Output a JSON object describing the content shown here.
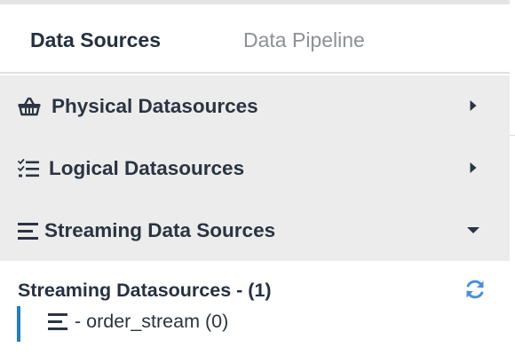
{
  "tabs": [
    {
      "label": "Data Sources",
      "active": true
    },
    {
      "label": "Data Pipeline",
      "active": false
    }
  ],
  "sections": [
    {
      "label": "Physical Datasources",
      "icon": "basket-icon",
      "caret": "caret-right-icon",
      "expanded": false
    },
    {
      "label": "Logical Datasources",
      "icon": "checklist-icon",
      "caret": "caret-right-icon",
      "expanded": false
    },
    {
      "label": "Streaming Data Sources",
      "icon": "bars-icon",
      "caret": "caret-down-icon",
      "expanded": true
    }
  ],
  "streaming": {
    "group_title": "Streaming Datasources - (1)",
    "refresh_icon": "refresh-icon",
    "items": [
      {
        "label": "- order_stream (0)",
        "icon": "bars-icon"
      }
    ]
  },
  "colors": {
    "accent": "#1e7fc6",
    "refresh": "#4a90d9",
    "section_bg": "#ececec",
    "active_tab": "#253142",
    "inactive_tab": "#8d9096"
  }
}
